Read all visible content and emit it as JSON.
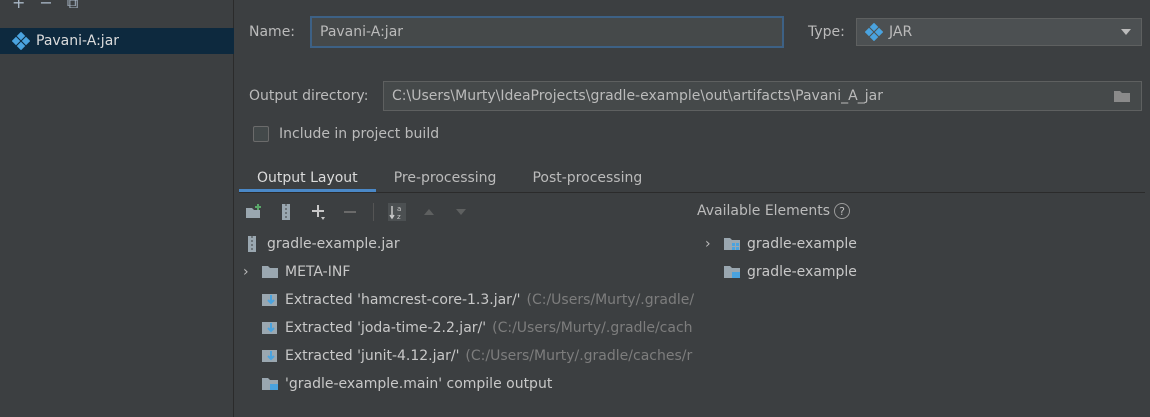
{
  "toolbar": {
    "add": "+",
    "remove": "−",
    "copy": "⧉"
  },
  "artifacts": [
    {
      "label": "Pavani-A:jar"
    }
  ],
  "form": {
    "name_label": "Name:",
    "name_value": "Pavani-A:jar",
    "type_label": "Type:",
    "type_value": "JAR",
    "output_dir_label": "Output directory:",
    "output_dir_value": "C:\\Users\\Murty\\IdeaProjects\\gradle-example\\out\\artifacts\\Pavani_A_jar",
    "include_label": "Include in project build",
    "include_checked": false
  },
  "tabs": [
    {
      "label": "Output Layout",
      "active": true
    },
    {
      "label": "Pre-processing",
      "active": false
    },
    {
      "label": "Post-processing",
      "active": false
    }
  ],
  "layout_tree": [
    {
      "label": "gradle-example.jar",
      "suffix": ""
    },
    {
      "label": "META-INF",
      "suffix": ""
    },
    {
      "label": "Extracted 'hamcrest-core-1.3.jar/'",
      "suffix": " (C:/Users/Murty/.gradle/"
    },
    {
      "label": "Extracted 'joda-time-2.2.jar/'",
      "suffix": " (C:/Users/Murty/.gradle/cach"
    },
    {
      "label": "Extracted 'junit-4.12.jar/'",
      "suffix": " (C:/Users/Murty/.gradle/caches/r"
    },
    {
      "label": "'gradle-example.main' compile output",
      "suffix": ""
    }
  ],
  "available": {
    "label": "Available Elements",
    "help": "?",
    "items": [
      {
        "label": "gradle-example"
      },
      {
        "label": "gradle-example"
      }
    ]
  },
  "colors": {
    "accent": "#4a88c7",
    "selection": "#0d293e",
    "background": "#3c3f41"
  }
}
